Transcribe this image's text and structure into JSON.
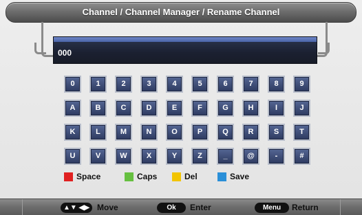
{
  "title": "Channel / Channel Manager / Rename Channel",
  "input": {
    "value": "000"
  },
  "keyboard": {
    "rows": [
      [
        "0",
        "1",
        "2",
        "3",
        "4",
        "5",
        "6",
        "7",
        "8",
        "9"
      ],
      [
        "A",
        "B",
        "C",
        "D",
        "E",
        "F",
        "G",
        "H",
        "I",
        "J"
      ],
      [
        "K",
        "L",
        "M",
        "N",
        "O",
        "P",
        "Q",
        "R",
        "S",
        "T"
      ],
      [
        "U",
        "V",
        "W",
        "X",
        "Y",
        "Z",
        "_",
        "@",
        "-",
        "#"
      ]
    ]
  },
  "legend": [
    {
      "label": "Space",
      "color": "#e02020"
    },
    {
      "label": "Caps",
      "color": "#66c040"
    },
    {
      "label": "Del",
      "color": "#f2c400"
    },
    {
      "label": "Save",
      "color": "#2a8fd8"
    }
  ],
  "footer": {
    "move_keys": "▲▼ ◀▶",
    "move_label": "Move",
    "ok_key": "Ok",
    "ok_label": "Enter",
    "menu_key": "Menu",
    "menu_label": "Return"
  }
}
